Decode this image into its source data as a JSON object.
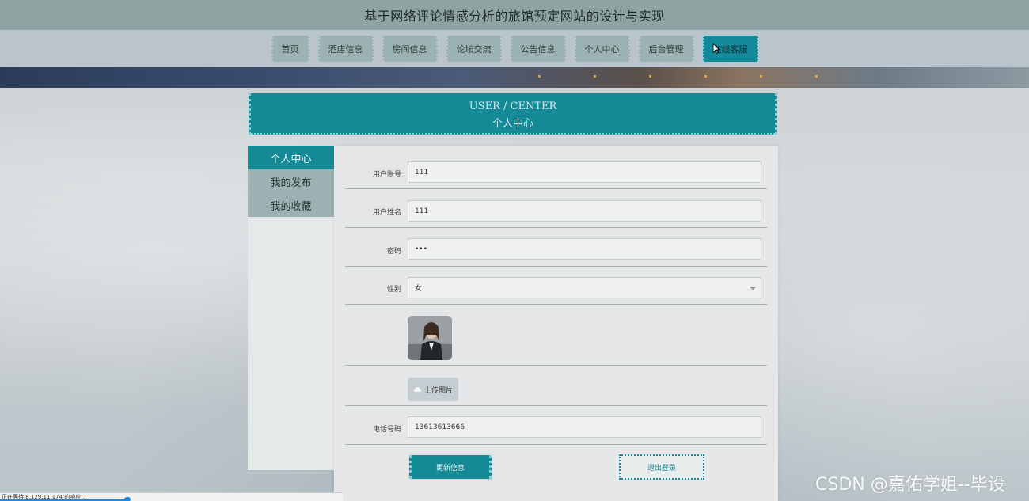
{
  "site": {
    "title": "基于网络评论情感分析的旅馆预定网站的设计与实现"
  },
  "nav": {
    "items": [
      {
        "label": "首页",
        "name": "nav-home"
      },
      {
        "label": "酒店信息",
        "name": "nav-hotel-info"
      },
      {
        "label": "房间信息",
        "name": "nav-room-info"
      },
      {
        "label": "论坛交流",
        "name": "nav-forum"
      },
      {
        "label": "公告信息",
        "name": "nav-announcements"
      },
      {
        "label": "个人中心",
        "name": "nav-user-center"
      },
      {
        "label": "后台管理",
        "name": "nav-admin"
      },
      {
        "label": "在线客服",
        "name": "nav-online-service"
      }
    ],
    "active_index": 7
  },
  "header": {
    "en": "USER / CENTER",
    "cn": "个人中心"
  },
  "sidebar": {
    "items": [
      {
        "label": "个人中心",
        "active": true
      },
      {
        "label": "我的发布",
        "active": false
      },
      {
        "label": "我的收藏",
        "active": false
      }
    ]
  },
  "form": {
    "account": {
      "label": "用户账号",
      "value": "111"
    },
    "name": {
      "label": "用户姓名",
      "value": "111"
    },
    "password": {
      "label": "密码",
      "value": "•••"
    },
    "gender": {
      "label": "性别",
      "value": "女"
    },
    "upload_label": "上传图片",
    "phone": {
      "label": "电话号码",
      "value": "13613613666"
    },
    "update_button": "更新信息",
    "logout_button": "退出登录"
  },
  "status_bar": {
    "text": "正在等待 8.129.11.174 的响应..."
  },
  "watermark": "CSDN @嘉佑学姐--毕设",
  "colors": {
    "accent": "#138a96",
    "nav_item": "#9cb1b1",
    "title_bar": "#8fa3a3"
  }
}
